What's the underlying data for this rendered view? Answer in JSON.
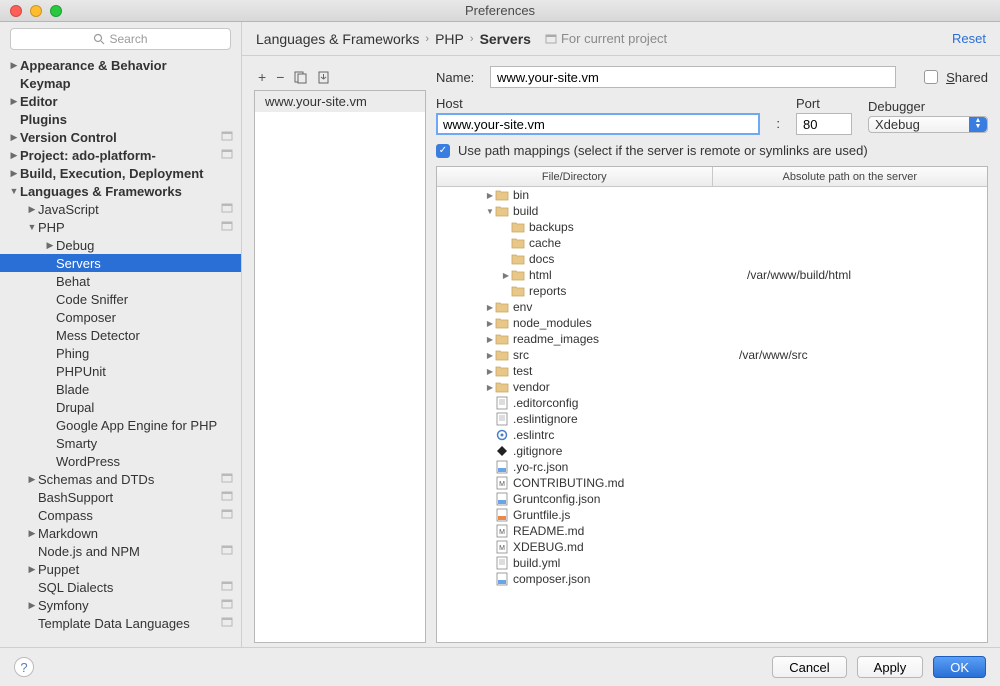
{
  "window": {
    "title": "Preferences"
  },
  "search": {
    "placeholder": "Search"
  },
  "sidebar": {
    "items": [
      {
        "label": "Appearance & Behavior",
        "depth": 0,
        "arrow": "▶",
        "bold": true
      },
      {
        "label": "Keymap",
        "depth": 0,
        "arrow": "",
        "bold": true
      },
      {
        "label": "Editor",
        "depth": 0,
        "arrow": "▶",
        "bold": true
      },
      {
        "label": "Plugins",
        "depth": 0,
        "arrow": "",
        "bold": true
      },
      {
        "label": "Version Control",
        "depth": 0,
        "arrow": "▶",
        "bold": true,
        "badge": true
      },
      {
        "label": "Project: ado-platform-",
        "depth": 0,
        "arrow": "▶",
        "bold": true,
        "badge": true
      },
      {
        "label": "Build, Execution, Deployment",
        "depth": 0,
        "arrow": "▶",
        "bold": true
      },
      {
        "label": "Languages & Frameworks",
        "depth": 0,
        "arrow": "▼",
        "bold": true
      },
      {
        "label": "JavaScript",
        "depth": 1,
        "arrow": "▶",
        "badge": true
      },
      {
        "label": "PHP",
        "depth": 1,
        "arrow": "▼",
        "badge": true
      },
      {
        "label": "Debug",
        "depth": 2,
        "arrow": "▶"
      },
      {
        "label": "Servers",
        "depth": 2,
        "arrow": "",
        "selected": true
      },
      {
        "label": "Behat",
        "depth": 2,
        "arrow": ""
      },
      {
        "label": "Code Sniffer",
        "depth": 2,
        "arrow": ""
      },
      {
        "label": "Composer",
        "depth": 2,
        "arrow": ""
      },
      {
        "label": "Mess Detector",
        "depth": 2,
        "arrow": ""
      },
      {
        "label": "Phing",
        "depth": 2,
        "arrow": ""
      },
      {
        "label": "PHPUnit",
        "depth": 2,
        "arrow": ""
      },
      {
        "label": "Blade",
        "depth": 2,
        "arrow": ""
      },
      {
        "label": "Drupal",
        "depth": 2,
        "arrow": ""
      },
      {
        "label": "Google App Engine for PHP",
        "depth": 2,
        "arrow": ""
      },
      {
        "label": "Smarty",
        "depth": 2,
        "arrow": ""
      },
      {
        "label": "WordPress",
        "depth": 2,
        "arrow": ""
      },
      {
        "label": "Schemas and DTDs",
        "depth": 1,
        "arrow": "▶",
        "badge": true
      },
      {
        "label": "BashSupport",
        "depth": 1,
        "arrow": "",
        "badge": true
      },
      {
        "label": "Compass",
        "depth": 1,
        "arrow": "",
        "badge": true
      },
      {
        "label": "Markdown",
        "depth": 1,
        "arrow": "▶"
      },
      {
        "label": "Node.js and NPM",
        "depth": 1,
        "arrow": "",
        "badge": true
      },
      {
        "label": "Puppet",
        "depth": 1,
        "arrow": "▶"
      },
      {
        "label": "SQL Dialects",
        "depth": 1,
        "arrow": "",
        "badge": true
      },
      {
        "label": "Symfony",
        "depth": 1,
        "arrow": "▶",
        "badge": true
      },
      {
        "label": "Template Data Languages",
        "depth": 1,
        "arrow": "",
        "badge": true
      }
    ]
  },
  "breadcrumb": {
    "a": "Languages & Frameworks",
    "b": "PHP",
    "c": "Servers",
    "project": "For current project"
  },
  "reset": "Reset",
  "servers": {
    "items": [
      "www.your-site.vm"
    ]
  },
  "form": {
    "name_label": "Name:",
    "name_value": "www.your-site.vm",
    "shared_label": "Shared",
    "host_label": "Host",
    "host_value": "www.your-site.vm",
    "port_label": "Port",
    "port_value": "80",
    "debugger_label": "Debugger",
    "debugger_value": "Xdebug",
    "colon": ":",
    "pathmap_label": "Use path mappings (select if the server is remote or symlinks are used)"
  },
  "pathtable": {
    "col1": "File/Directory",
    "col2": "Absolute path on the server",
    "rows": [
      {
        "depth": 3,
        "arrow": "▶",
        "icon": "folder",
        "label": "bin",
        "abs": ""
      },
      {
        "depth": 3,
        "arrow": "▼",
        "icon": "folder",
        "label": "build",
        "abs": ""
      },
      {
        "depth": 4,
        "arrow": "",
        "icon": "folder",
        "label": "backups",
        "abs": ""
      },
      {
        "depth": 4,
        "arrow": "",
        "icon": "folder",
        "label": "cache",
        "abs": ""
      },
      {
        "depth": 4,
        "arrow": "",
        "icon": "folder",
        "label": "docs",
        "abs": ""
      },
      {
        "depth": 4,
        "arrow": "▶",
        "icon": "folder",
        "label": "html",
        "abs": "/var/www/build/html"
      },
      {
        "depth": 4,
        "arrow": "",
        "icon": "folder",
        "label": "reports",
        "abs": ""
      },
      {
        "depth": 3,
        "arrow": "▶",
        "icon": "folder",
        "label": "env",
        "abs": ""
      },
      {
        "depth": 3,
        "arrow": "▶",
        "icon": "folder",
        "label": "node_modules",
        "abs": ""
      },
      {
        "depth": 3,
        "arrow": "▶",
        "icon": "folder",
        "label": "readme_images",
        "abs": ""
      },
      {
        "depth": 3,
        "arrow": "▶",
        "icon": "folder",
        "label": "src",
        "abs": "/var/www/src"
      },
      {
        "depth": 3,
        "arrow": "▶",
        "icon": "folder",
        "label": "test",
        "abs": ""
      },
      {
        "depth": 3,
        "arrow": "▶",
        "icon": "folder",
        "label": "vendor",
        "abs": ""
      },
      {
        "depth": 3,
        "arrow": "",
        "icon": "file",
        "label": ".editorconfig",
        "abs": ""
      },
      {
        "depth": 3,
        "arrow": "",
        "icon": "file",
        "label": ".eslintignore",
        "abs": ""
      },
      {
        "depth": 3,
        "arrow": "",
        "icon": "gear",
        "label": ".eslintrc",
        "abs": ""
      },
      {
        "depth": 3,
        "arrow": "",
        "icon": "diamond",
        "label": ".gitignore",
        "abs": ""
      },
      {
        "depth": 3,
        "arrow": "",
        "icon": "json",
        "label": ".yo-rc.json",
        "abs": ""
      },
      {
        "depth": 3,
        "arrow": "",
        "icon": "md",
        "label": "CONTRIBUTING.md",
        "abs": ""
      },
      {
        "depth": 3,
        "arrow": "",
        "icon": "json",
        "label": "Gruntconfig.json",
        "abs": ""
      },
      {
        "depth": 3,
        "arrow": "",
        "icon": "js",
        "label": "Gruntfile.js",
        "abs": ""
      },
      {
        "depth": 3,
        "arrow": "",
        "icon": "md",
        "label": "README.md",
        "abs": ""
      },
      {
        "depth": 3,
        "arrow": "",
        "icon": "md",
        "label": "XDEBUG.md",
        "abs": ""
      },
      {
        "depth": 3,
        "arrow": "",
        "icon": "file",
        "label": "build.yml",
        "abs": ""
      },
      {
        "depth": 3,
        "arrow": "",
        "icon": "json",
        "label": "composer.json",
        "abs": ""
      }
    ]
  },
  "buttons": {
    "cancel": "Cancel",
    "apply": "Apply",
    "ok": "OK"
  }
}
